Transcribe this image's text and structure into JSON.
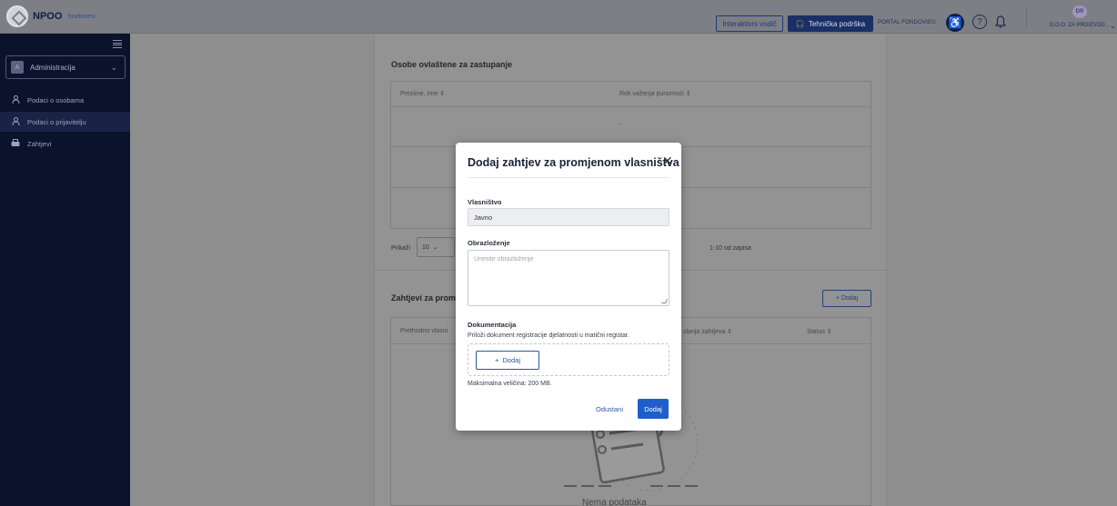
{
  "header": {
    "brand_name": "NPOO",
    "brand_suffix": "fondovieu",
    "guide_label": "Interaktivni vodič",
    "support_label": "Tehnička podrška",
    "portal_label": "PORTAL FONDOVIEU",
    "user_initials": "DR",
    "user_name": "D.O.O. ZA PROIZVOD..."
  },
  "sidebar": {
    "role": {
      "badge": "A",
      "label": "Administracija"
    },
    "items": [
      {
        "label": "Podaci o osobama",
        "icon": "user-icon",
        "active": false
      },
      {
        "label": "Podaci o prijavitelju",
        "icon": "user-icon",
        "active": true
      },
      {
        "label": "Zahtjevi",
        "icon": "requests-icon",
        "active": false
      }
    ]
  },
  "main": {
    "section1": {
      "title": "Osobe ovlaštene za zastupanje",
      "col1": "Prezime, Ime",
      "col2": "Rok važenja punomoći",
      "row1_value": "-",
      "pager_prefix": "Prikaži",
      "page_size": "10",
      "record_count": "1-10 od zapisa"
    },
    "section2": {
      "title": "Zahtjevi za prom",
      "add_label": "+ Dodaj",
      "col1": "Prethodno vlasni",
      "col2": "slanja zahtjeva",
      "col3": "Status",
      "empty_text": "Nema podataka"
    }
  },
  "modal": {
    "title": "Dodaj zahtjev za promjenom vlasništva",
    "close_glyph": "✕",
    "ownership_label": "Vlasništvo",
    "ownership_value": "Javno",
    "reason_label": "Obrazloženje",
    "reason_placeholder": "Unesite obrazloženje",
    "docs_label": "Dokumentacija",
    "docs_hint": "Priloži dokument registracije djelatnosti u matični registar.",
    "add_label": "Dodaj",
    "max_size": "Maksimalna veličina: 200 MB.",
    "cancel_label": "Odustani",
    "submit_label": "Dodaj"
  },
  "colors": {
    "sidebar_bg": "#0b132c",
    "primary": "#1f5ec9",
    "overlay_bg": "#8f8f8f"
  }
}
